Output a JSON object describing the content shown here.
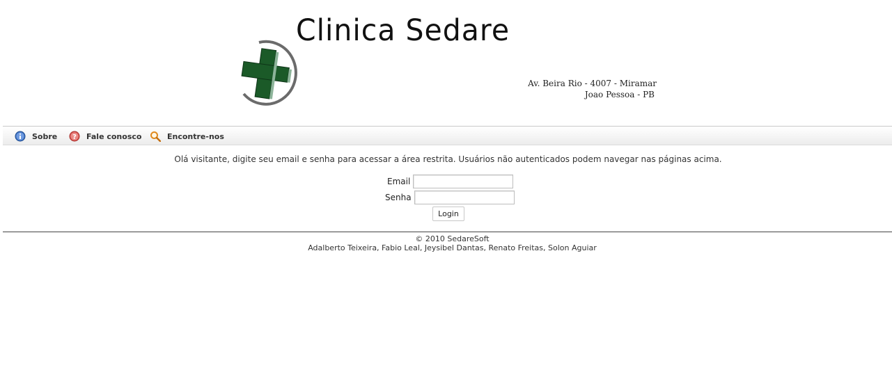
{
  "header": {
    "title": "Clinica Sedare",
    "address_line1": "Av. Beira Rio - 4007 - Miramar",
    "address_line2": "Joao Pessoa - PB",
    "logo": "green-cross-logo"
  },
  "menu": {
    "items": [
      {
        "label": "Sobre",
        "icon": "info-icon"
      },
      {
        "label": "Fale conosco",
        "icon": "help-icon"
      },
      {
        "label": "Encontre-nos",
        "icon": "search-icon"
      }
    ]
  },
  "main": {
    "intro": "Olá visitante, digite seu email e senha para acessar a área restrita. Usuários não autenticados podem navegar nas páginas acima.",
    "email_label": "Email",
    "email_value": "",
    "senha_label": "Senha",
    "senha_value": "",
    "login_label": "Login"
  },
  "footer": {
    "copyright": "© 2010 SedareSoft",
    "authors": "Adalberto Teixeira, Fabio Leal, Jeysibel Dantas, Renato Freitas, Solon Aguiar"
  },
  "colors": {
    "cross_green": "#1e5e2a",
    "info_blue": "#3b6fc2",
    "help_red": "#d9534f",
    "search_orange": "#e08a1e"
  }
}
